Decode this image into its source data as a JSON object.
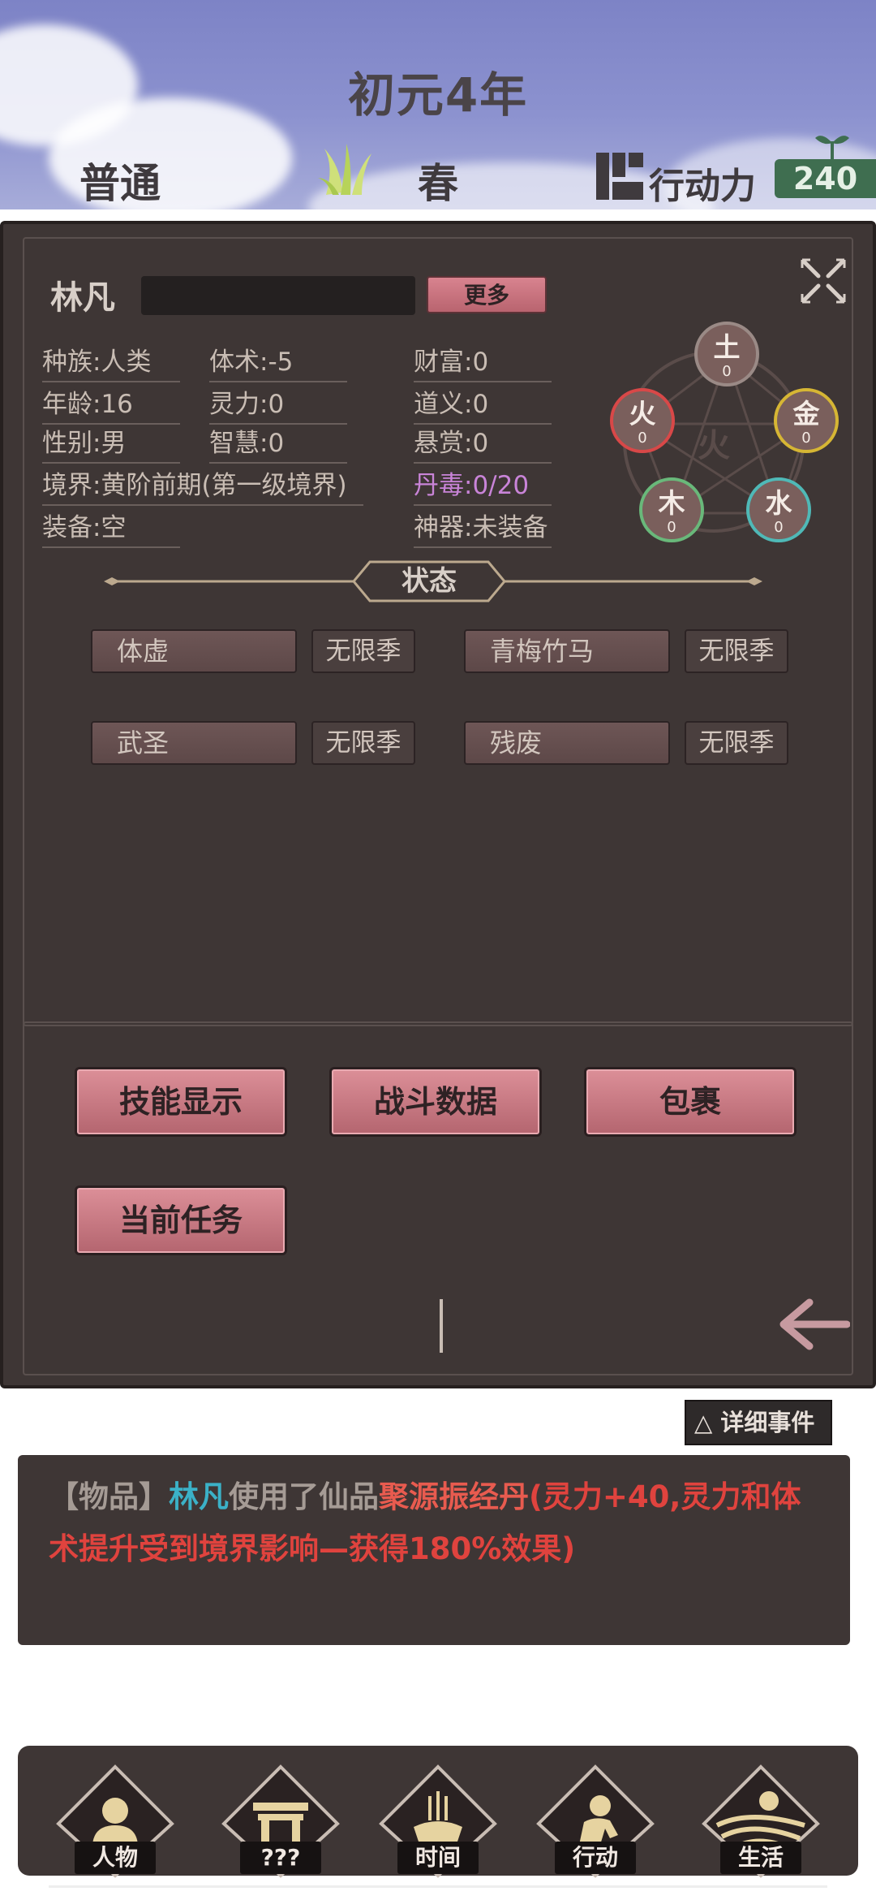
{
  "header": {
    "title": "初元4年",
    "mode": "普通",
    "season": "春",
    "action_points_label": "行动力",
    "action_points_value": "240"
  },
  "character": {
    "name": "林凡",
    "more_button": "更多",
    "stats": {
      "race": "种族:人类",
      "body": "体术:-5",
      "wealth": "财富:0",
      "age": "年龄:16",
      "spirit": "灵力:0",
      "morality": "道义:0",
      "gender": "性别:男",
      "wisdom": "智慧:0",
      "bounty": "悬赏:0",
      "realm": "境界:黄阶前期(第一级境界)",
      "pill_poison": "丹毒:0/20",
      "equipment": "装备:空",
      "artifact": "神器:未装备"
    },
    "wuxing": {
      "center": "火",
      "elements": [
        {
          "name": "土",
          "value": "0"
        },
        {
          "name": "金",
          "value": "0"
        },
        {
          "name": "水",
          "value": "0"
        },
        {
          "name": "木",
          "value": "0"
        },
        {
          "name": "火",
          "value": "0"
        }
      ]
    }
  },
  "status": {
    "title": "状态",
    "buffs": [
      {
        "name": "体虚",
        "duration": "无限季"
      },
      {
        "name": "青梅竹马",
        "duration": "无限季"
      },
      {
        "name": "武圣",
        "duration": "无限季"
      },
      {
        "name": "残废",
        "duration": "无限季"
      }
    ]
  },
  "actions": {
    "skills": "技能显示",
    "combat": "战斗数据",
    "bag": "包裹",
    "quest": "当前任务"
  },
  "events": {
    "detail_button": "△ 详细事件",
    "tag": "【物品】",
    "name": "林凡",
    "text": "使用了仙品",
    "item": "聚源振经丹",
    "effect": "(灵力+40,灵力和体术提升受到境界影响—获得180%效果)"
  },
  "nav": {
    "items": [
      {
        "label": "人物",
        "icon": "person-icon"
      },
      {
        "label": "???",
        "icon": "gate-icon"
      },
      {
        "label": "时间",
        "icon": "incense-icon"
      },
      {
        "label": "行动",
        "icon": "action-icon"
      },
      {
        "label": "生活",
        "icon": "life-icon"
      }
    ]
  },
  "colors": {
    "panel": "#3e3635",
    "button_pink": "#c9737d",
    "poison": "#c984d8",
    "event_name": "#3bb1c7",
    "event_red": "#e0433e"
  }
}
